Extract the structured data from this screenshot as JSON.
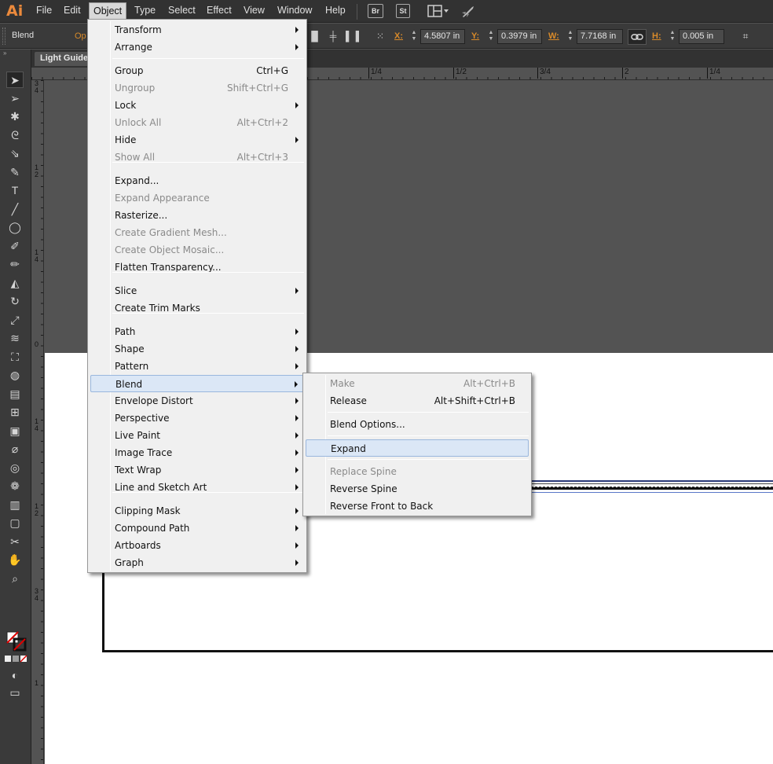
{
  "menubar": {
    "logo": "Ai",
    "items": [
      "File",
      "Edit",
      "Object",
      "Type",
      "Select",
      "Effect",
      "View",
      "Window",
      "Help"
    ],
    "bridge_label": "Br",
    "stock_label": "St",
    "arrange_icon": "arrange-documents-icon",
    "gpu_icon": "gpu-rocket-icon"
  },
  "controlbar": {
    "object_type": "Blend",
    "opacity_label": "Op",
    "x_label": "X:",
    "x_value": "4.5807 in",
    "y_label": "Y:",
    "y_value": "0.3979 in",
    "w_label": "W:",
    "w_value": "7.7168 in",
    "h_label": "H:",
    "h_value": "0.005 in"
  },
  "document": {
    "tab_title": "Light Guide"
  },
  "rulers": {
    "h_labels": [
      "1/4",
      "1/2",
      "3/4",
      "2",
      "1/4"
    ],
    "v_labels": [
      "3 4",
      "1 2",
      "1 4",
      "0",
      "1 4",
      "1 2",
      "3 4",
      "1"
    ]
  },
  "object_menu": {
    "items": [
      {
        "label": "Transform",
        "shortcut": "",
        "submenu": true,
        "disabled": false
      },
      {
        "label": "Arrange",
        "shortcut": "",
        "submenu": true,
        "disabled": false
      },
      {
        "label": "Group",
        "shortcut": "Ctrl+G",
        "submenu": false,
        "disabled": false
      },
      {
        "label": "Ungroup",
        "shortcut": "Shift+Ctrl+G",
        "submenu": false,
        "disabled": true
      },
      {
        "label": "Lock",
        "shortcut": "",
        "submenu": true,
        "disabled": false
      },
      {
        "label": "Unlock All",
        "shortcut": "Alt+Ctrl+2",
        "submenu": false,
        "disabled": true
      },
      {
        "label": "Hide",
        "shortcut": "",
        "submenu": true,
        "disabled": false
      },
      {
        "label": "Show All",
        "shortcut": "Alt+Ctrl+3",
        "submenu": false,
        "disabled": true
      },
      {
        "label": "Expand...",
        "shortcut": "",
        "submenu": false,
        "disabled": false
      },
      {
        "label": "Expand Appearance",
        "shortcut": "",
        "submenu": false,
        "disabled": true
      },
      {
        "label": "Rasterize...",
        "shortcut": "",
        "submenu": false,
        "disabled": false
      },
      {
        "label": "Create Gradient Mesh...",
        "shortcut": "",
        "submenu": false,
        "disabled": true
      },
      {
        "label": "Create Object Mosaic...",
        "shortcut": "",
        "submenu": false,
        "disabled": true
      },
      {
        "label": "Flatten Transparency...",
        "shortcut": "",
        "submenu": false,
        "disabled": false
      },
      {
        "label": "Slice",
        "shortcut": "",
        "submenu": true,
        "disabled": false
      },
      {
        "label": "Create Trim Marks",
        "shortcut": "",
        "submenu": false,
        "disabled": false
      },
      {
        "label": "Path",
        "shortcut": "",
        "submenu": true,
        "disabled": false
      },
      {
        "label": "Shape",
        "shortcut": "",
        "submenu": true,
        "disabled": false
      },
      {
        "label": "Pattern",
        "shortcut": "",
        "submenu": true,
        "disabled": false
      },
      {
        "label": "Blend",
        "shortcut": "",
        "submenu": true,
        "disabled": false
      },
      {
        "label": "Envelope Distort",
        "shortcut": "",
        "submenu": true,
        "disabled": false
      },
      {
        "label": "Perspective",
        "shortcut": "",
        "submenu": true,
        "disabled": false
      },
      {
        "label": "Live Paint",
        "shortcut": "",
        "submenu": true,
        "disabled": false
      },
      {
        "label": "Image Trace",
        "shortcut": "",
        "submenu": true,
        "disabled": false
      },
      {
        "label": "Text Wrap",
        "shortcut": "",
        "submenu": true,
        "disabled": false
      },
      {
        "label": "Line and Sketch Art",
        "shortcut": "",
        "submenu": true,
        "disabled": false
      },
      {
        "label": "Clipping Mask",
        "shortcut": "",
        "submenu": true,
        "disabled": false
      },
      {
        "label": "Compound Path",
        "shortcut": "",
        "submenu": true,
        "disabled": false
      },
      {
        "label": "Artboards",
        "shortcut": "",
        "submenu": true,
        "disabled": false
      },
      {
        "label": "Graph",
        "shortcut": "",
        "submenu": true,
        "disabled": false
      }
    ]
  },
  "blend_menu": {
    "items": [
      {
        "label": "Make",
        "shortcut": "Alt+Ctrl+B",
        "disabled": true
      },
      {
        "label": "Release",
        "shortcut": "Alt+Shift+Ctrl+B",
        "disabled": false
      },
      {
        "label": "Blend Options...",
        "shortcut": "",
        "disabled": false
      },
      {
        "label": "Expand",
        "shortcut": "",
        "disabled": false
      },
      {
        "label": "Replace Spine",
        "shortcut": "",
        "disabled": true
      },
      {
        "label": "Reverse Spine",
        "shortcut": "",
        "disabled": false
      },
      {
        "label": "Reverse Front to Back",
        "shortcut": "",
        "disabled": false
      }
    ]
  },
  "tools": [
    "selection-tool",
    "direct-selection-tool",
    "magic-wand-tool",
    "lasso-tool",
    "pen-tool",
    "curvature-tool",
    "type-tool",
    "line-segment-tool",
    "ellipse-tool",
    "paintbrush-tool",
    "pencil-tool",
    "eraser-tool",
    "rotate-tool",
    "scale-tool",
    "width-tool",
    "free-transform-tool",
    "shape-builder-tool",
    "perspective-grid-tool",
    "mesh-tool",
    "gradient-tool",
    "eyedropper-tool",
    "blend-tool",
    "symbol-sprayer-tool",
    "column-graph-tool",
    "artboard-tool",
    "slice-tool",
    "hand-tool",
    "zoom-tool"
  ],
  "colors": {
    "accent_orange": "#d88a2a",
    "menu_highlight": "#dbe7f6"
  }
}
